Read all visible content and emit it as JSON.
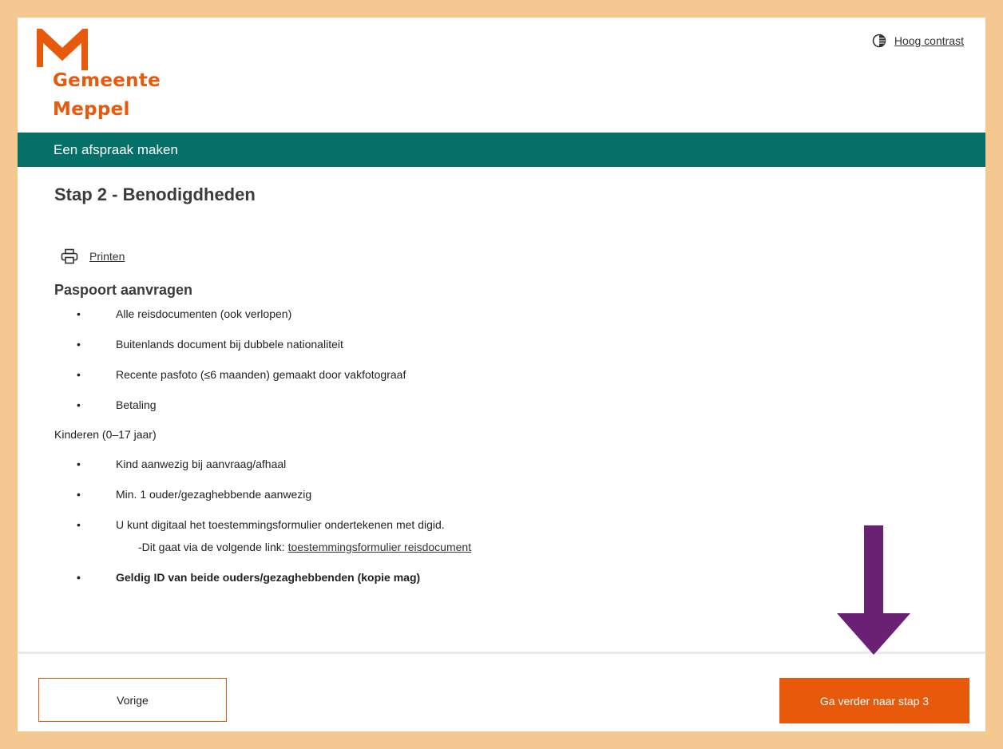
{
  "header": {
    "logo_line1": "Gemeente",
    "logo_line2": "Meppel",
    "contrast_label": "Hoog contrast"
  },
  "bar": {
    "title": "Een afspraak maken"
  },
  "step": {
    "title": "Stap 2 - Benodigdheden"
  },
  "print": {
    "label": "Printen"
  },
  "section": {
    "title": "Paspoort aanvragen",
    "items": [
      "Alle reisdocumenten (ook verlopen)",
      "Buitenlands document bij dubbele nationaliteit",
      "Recente pasfoto (≤6 maanden) gemaakt door vakfotograaf",
      "Betaling"
    ],
    "kids_heading": "Kinderen (0–17 jaar)",
    "kids_items": [
      "Kind aanwezig bij aanvraag/afhaal",
      "Min. 1 ouder/gezaghebbende aanwezig",
      "U kunt digitaal het toestemmingsformulier ondertekenen met digid."
    ],
    "kids_subline_prefix": "-Dit gaat via de volgende link:",
    "kids_link": "toestemmingsformulier reisdocument",
    "kids_last": "Geldig ID van beide ouders/gezaghebbenden (kopie mag)"
  },
  "footer": {
    "prev_label": "Vorige",
    "next_label": "Ga verder naar stap 3"
  },
  "colors": {
    "brand_orange": "#e8590c",
    "bar_teal": "#047068",
    "arrow_purple": "#6b2173",
    "frame": "#f6c891"
  },
  "icons": {
    "contrast": "contrast-icon",
    "print": "printer-icon",
    "logo": "logo-m-icon",
    "arrow": "down-arrow-icon"
  }
}
